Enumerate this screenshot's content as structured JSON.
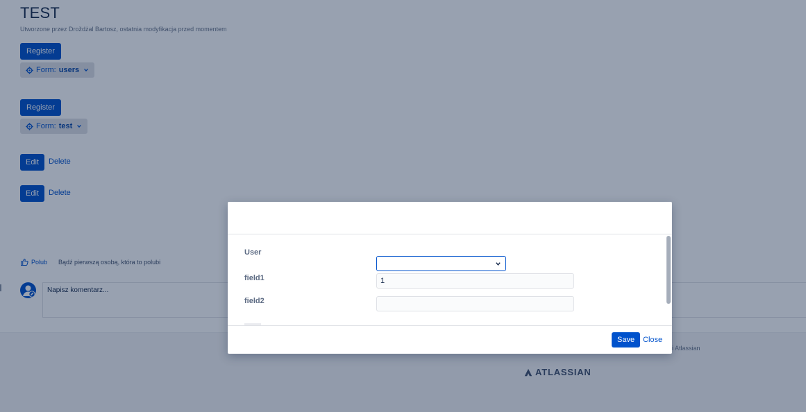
{
  "page": {
    "title": "TEST",
    "byline": "Utworzone przez Droždżal Bartosz, ostatnia modyfikacja przed momentem"
  },
  "forms": [
    {
      "register_label": "Register",
      "form_prefix": "Form:",
      "form_name": "users"
    },
    {
      "register_label": "Register",
      "form_prefix": "Form:",
      "form_name": "test"
    }
  ],
  "actions": [
    {
      "edit_label": "Edit",
      "delete_label": "Delete"
    },
    {
      "edit_label": "Edit",
      "delete_label": "Delete"
    }
  ],
  "likes": {
    "like_label": "Polub",
    "first_label": "Bądź pierwszą osobą, która to polubi"
  },
  "comment": {
    "placeholder": "Napisz komentarz..."
  },
  "footer": {
    "text": "i Atlassian",
    "logo_text": "ATLASSIAN"
  },
  "dialog": {
    "fields": {
      "user_label": "User",
      "user_value": "",
      "field1_label": "field1",
      "field1_value": "1",
      "field2_label": "field2",
      "field2_value": ""
    },
    "save_label": "Save",
    "close_label": "Close"
  },
  "colors": {
    "primary": "#0052cc",
    "overlay": "rgba(9,30,66,0.42)"
  }
}
